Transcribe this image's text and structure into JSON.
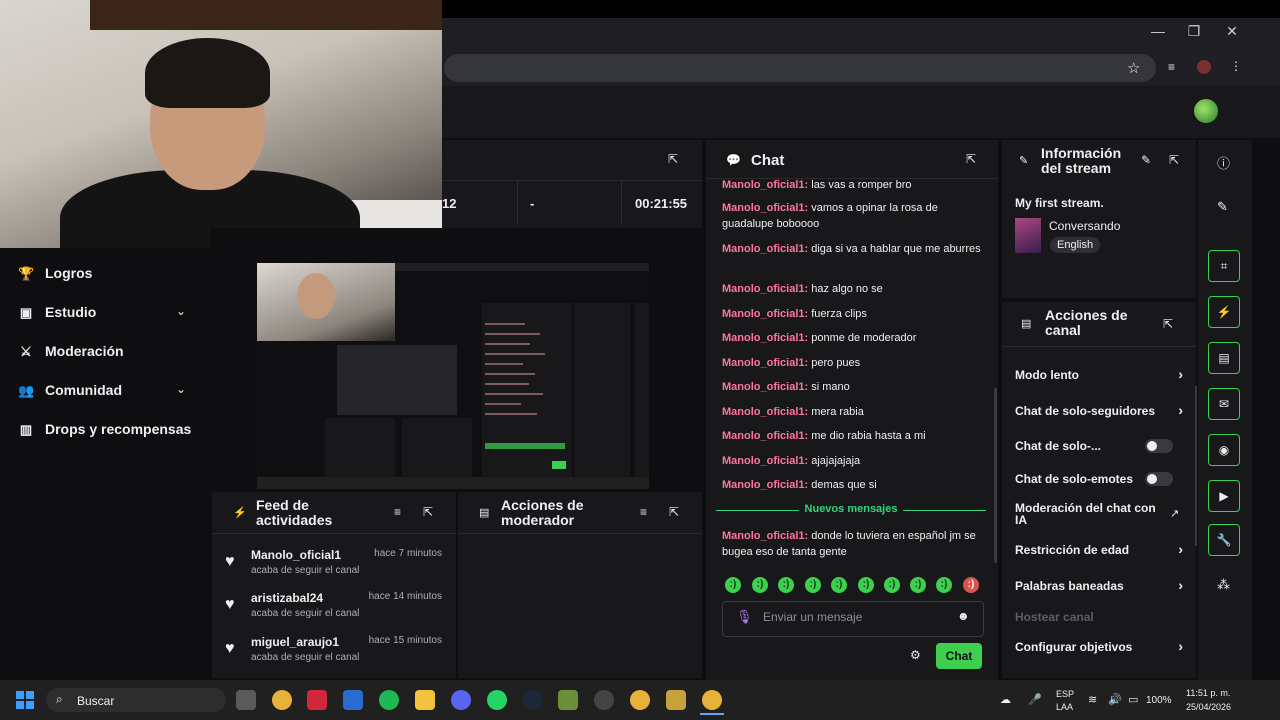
{
  "browser": {
    "window_controls": {
      "minimize": "—",
      "maximize": "❐",
      "close": "✕"
    }
  },
  "nav": {
    "items": [
      {
        "label": "Logros",
        "icon": "trophy-icon"
      },
      {
        "label": "Estudio",
        "icon": "studio-icon",
        "expandable": true
      },
      {
        "label": "Moderación",
        "icon": "sword-icon"
      },
      {
        "label": "Comunidad",
        "icon": "people-icon",
        "expandable": true
      },
      {
        "label": "Drops y recompensas",
        "icon": "bars-icon"
      }
    ]
  },
  "stats": {
    "value_a": "12",
    "value_b": "-",
    "session_time": "00:21:55"
  },
  "feed": {
    "title": "Feed de actividades",
    "items": [
      {
        "name": "Manolo_oficial1",
        "time": "hace 7 minutos",
        "action": "acaba de seguir el canal"
      },
      {
        "name": "aristizabal24",
        "time": "hace 14 minutos",
        "action": "acaba de seguir el canal"
      },
      {
        "name": "miguel_araujo1",
        "time": "hace 15 minutos",
        "action": "acaba de seguir el canal"
      }
    ]
  },
  "mod_actions": {
    "title": "Acciones de moderador"
  },
  "chat": {
    "title": "Chat",
    "messages": [
      {
        "user": "Manolo_oficial1:",
        "text": " las vas a romper bro"
      },
      {
        "user": "Manolo_oficial1:",
        "text": " vamos a opinar la rosa de guadalupe boboooo"
      },
      {
        "user": "Manolo_oficial1:",
        "text": " diga si va a hablar que me aburres"
      },
      {
        "user": "Manolo_oficial1:",
        "text": " haz algo no se"
      },
      {
        "user": "Manolo_oficial1:",
        "text": " fuerza clips"
      },
      {
        "user": "Manolo_oficial1:",
        "text": " ponme de moderador"
      },
      {
        "user": "Manolo_oficial1:",
        "text": " pero pues"
      },
      {
        "user": "Manolo_oficial1:",
        "text": " si mano"
      },
      {
        "user": "Manolo_oficial1:",
        "text": " mera rabia"
      },
      {
        "user": "Manolo_oficial1:",
        "text": " me dio rabia hasta a mi"
      },
      {
        "user": "Manolo_oficial1:",
        "text": " ajajajajaja"
      },
      {
        "user": "Manolo_oficial1:",
        "text": " demas que si"
      }
    ],
    "new_messages_label": "Nuevos mensajes",
    "new_message": {
      "user": "Manolo_oficial1:",
      "text": " donde lo tuviera en español jm se bugea eso de tanta gente"
    },
    "input_placeholder": "Enviar un mensaje",
    "send_label": "Chat"
  },
  "stream_info": {
    "title": "Información del stream",
    "stream_title": "My first stream.",
    "category": "Conversando",
    "language": "English"
  },
  "channel_actions": {
    "title": "Acciones de canal",
    "rows": [
      {
        "label": "Modo lento",
        "control": "chevron"
      },
      {
        "label": "Chat de solo-seguidores",
        "control": "chevron"
      },
      {
        "label": "Chat de solo-...",
        "control": "toggle"
      },
      {
        "label": "Chat de solo-emotes",
        "control": "toggle"
      },
      {
        "label": "Moderación del chat con IA",
        "control": "external"
      },
      {
        "label": "Restricción de edad",
        "control": "chevron"
      },
      {
        "label": "Palabras baneadas",
        "control": "chevron"
      },
      {
        "label": "Hostear canal",
        "control": "none",
        "disabled": true
      },
      {
        "label": "Configurar objetivos",
        "control": "chevron"
      }
    ]
  },
  "taskbar": {
    "search_label": "Buscar",
    "lang_top": "ESP",
    "lang_bottom": "LAA",
    "battery": "100%",
    "time": "11:51 p. m.",
    "date": "25/04/2026"
  },
  "colors": {
    "accent": "#3cd04e",
    "username": "#ff75a0",
    "panel": "#18181b",
    "bg": "#0e0e10"
  }
}
